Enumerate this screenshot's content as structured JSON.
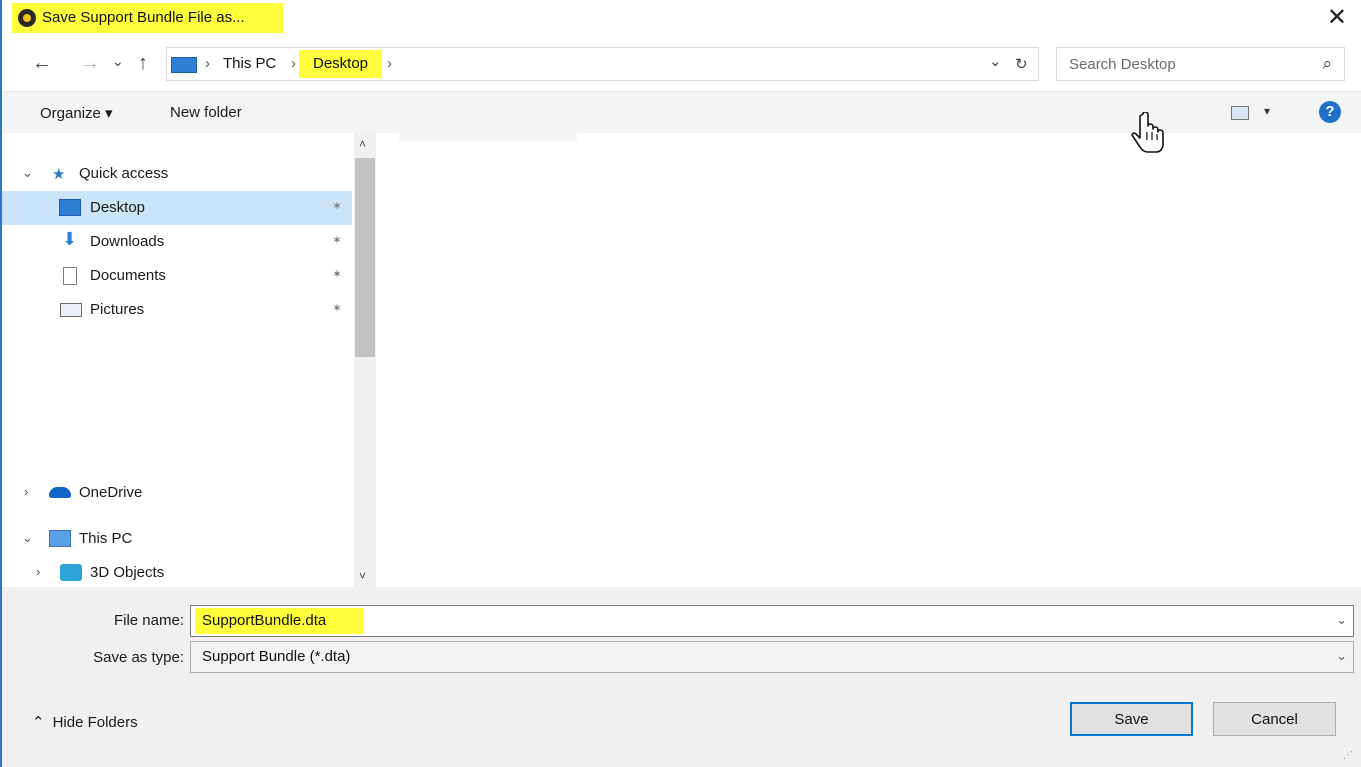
{
  "window": {
    "title": "Save Support Bundle File as...",
    "close_glyph": "✕"
  },
  "nav": {
    "back_glyph": "←",
    "forward_glyph": "→",
    "recent_glyph": "⌄",
    "up_glyph": "↑",
    "breadcrumb": [
      "This PC",
      "Desktop"
    ],
    "sep_glyph": "›",
    "dropdown_glyph": "⌄",
    "refresh_glyph": "↻"
  },
  "search": {
    "placeholder": "Search Desktop",
    "icon_glyph": "⌕"
  },
  "toolbar": {
    "organize_label": "Organize ▾",
    "new_folder_label": "New folder",
    "view_arrow_glyph": "▾",
    "help_glyph": "?"
  },
  "tree": {
    "quick_access": "Quick access",
    "items": [
      {
        "label": "Desktop",
        "icon": "desktop-icon",
        "pinned": true,
        "selected": true
      },
      {
        "label": "Downloads",
        "icon": "download-icon",
        "pinned": true
      },
      {
        "label": "Documents",
        "icon": "documents-icon",
        "pinned": true
      },
      {
        "label": "Pictures",
        "icon": "pictures-icon",
        "pinned": true
      }
    ],
    "onedrive": "OneDrive",
    "this_pc": "This PC",
    "objects_3d": "3D Objects",
    "expanded_glyph": "⌄",
    "collapsed_glyph": "›",
    "pin_glyph": "📌"
  },
  "scroll": {
    "up_glyph": "˄",
    "down_glyph": "˅"
  },
  "form": {
    "file_name_label": "File name:",
    "file_name_value": "SupportBundle.dta",
    "save_type_label": "Save as type:",
    "save_type_value": "Support Bundle (*.dta)",
    "arrow_glyph": "⌄"
  },
  "footer": {
    "hide_folders": "Hide Folders",
    "hide_glyph": "⌃",
    "save_label": "Save",
    "cancel_label": "Cancel"
  },
  "colors": {
    "highlight": "#ffff3c",
    "selection": "#cce4f7",
    "accent": "#0078d7"
  }
}
